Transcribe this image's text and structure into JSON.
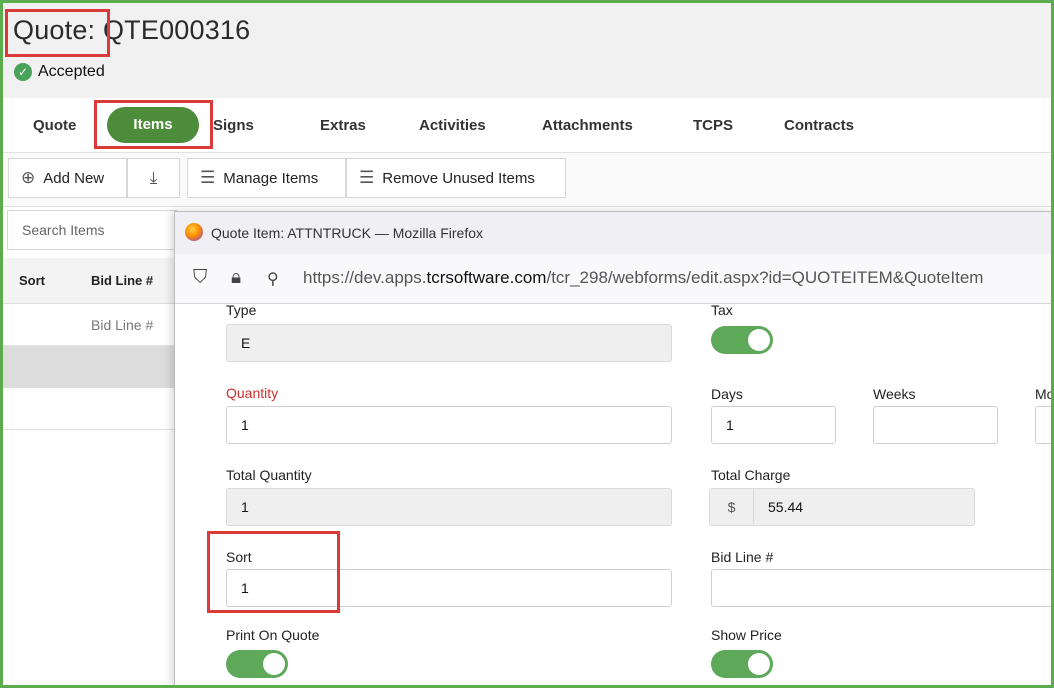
{
  "header": {
    "title_label": "Quote:",
    "quote_number": "QTE000316",
    "status": "Accepted"
  },
  "tabs": [
    {
      "label": "Quote"
    },
    {
      "label": "Items",
      "active": true
    },
    {
      "label": "Signs"
    },
    {
      "label": "Extras"
    },
    {
      "label": "Activities"
    },
    {
      "label": "Attachments"
    },
    {
      "label": "TCPS"
    },
    {
      "label": "Contracts"
    }
  ],
  "toolbar": {
    "add_new": "Add New",
    "manage_items": "Manage Items",
    "remove_unused": "Remove Unused Items"
  },
  "list": {
    "search_placeholder": "Search Items",
    "columns": [
      "Sort",
      "Bid Line #"
    ],
    "filter_placeholder": "Bid Line #"
  },
  "window": {
    "title": "Quote Item: ATTNTRUCK — Mozilla Firefox",
    "url_prefix": "https://dev.apps.",
    "url_domain": "tcrsoftware.com",
    "url_rest": "/tcr_298/webforms/edit.aspx?id=QUOTEITEM&QuoteItem"
  },
  "form": {
    "type_label": "Type",
    "type_value": "E",
    "tax_label": "Tax",
    "quantity_label": "Quantity",
    "quantity_value": "1",
    "days_label": "Days",
    "days_value": "1",
    "weeks_label": "Weeks",
    "weeks_value": "",
    "months_label": "Mo",
    "total_quantity_label": "Total Quantity",
    "total_quantity_value": "1",
    "total_charge_label": "Total Charge",
    "currency": "$",
    "total_charge_value": "55.44",
    "sort_label": "Sort",
    "sort_value": "1",
    "bid_line_label": "Bid Line #",
    "bid_line_value": "",
    "print_on_quote_label": "Print On Quote",
    "show_price_label": "Show Price"
  },
  "colors": {
    "accent": "#4d8c3a",
    "toggle_on": "#5ea85a",
    "highlight": "#d93a3a",
    "frame": "#5cab4c"
  }
}
